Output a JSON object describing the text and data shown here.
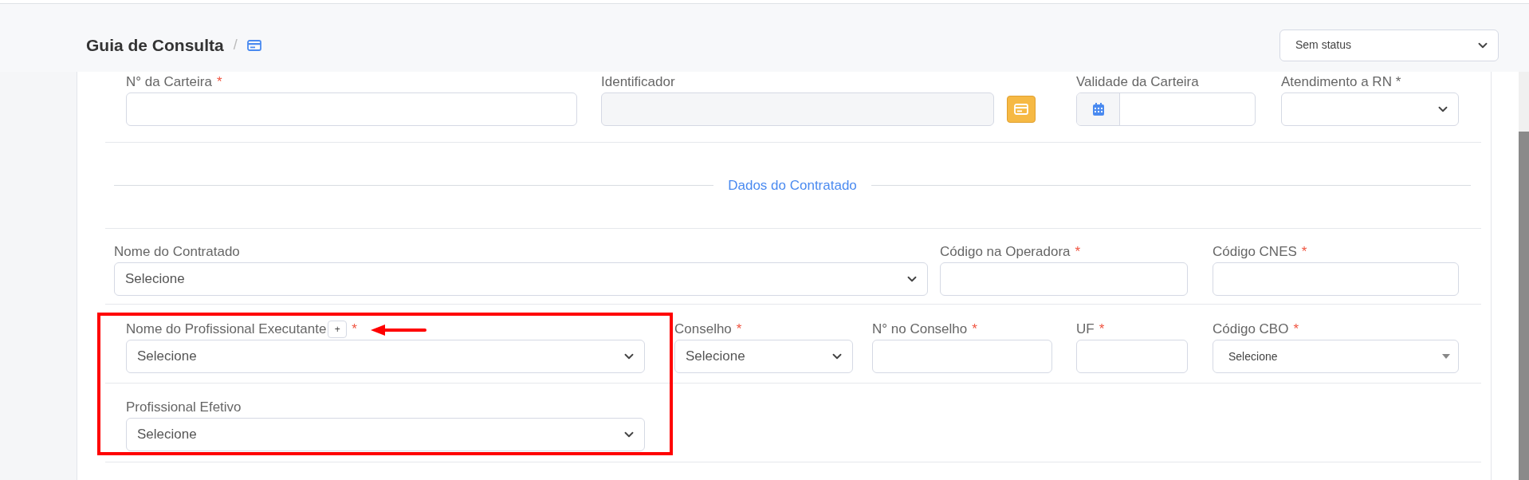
{
  "header": {
    "title": "Guia de Consulta",
    "separator": "/",
    "status_select": {
      "value": "Sem status"
    }
  },
  "rows": [
    {
      "fields": [
        {
          "label": "N° da Carteira",
          "required_mark": "*",
          "kind": "input"
        },
        {
          "label": "Identificador",
          "kind": "input",
          "disabled": true,
          "action_button": true
        },
        {
          "label": "Validade da Carteira",
          "kind": "date"
        },
        {
          "label": "Atendimento a RN *",
          "kind": "select"
        }
      ]
    },
    {
      "section_title": "Dados do Contratado"
    },
    {
      "fields": [
        {
          "label": "Nome do Contratado",
          "kind": "select",
          "value": "Selecione"
        },
        {
          "label": "Código na Operadora",
          "required_mark": "*",
          "kind": "input"
        },
        {
          "label": "Código CNES",
          "required_mark": "*",
          "kind": "input"
        }
      ]
    },
    {
      "fields": [
        {
          "label": "Nome do Profissional Executante",
          "required_mark": "*",
          "kind": "select",
          "value": "Selecione",
          "add_button": "+"
        },
        {
          "label": "Conselho",
          "required_mark": "*",
          "kind": "select",
          "value": "Selecione"
        },
        {
          "label": "N° no Conselho",
          "required_mark": "*",
          "kind": "input"
        },
        {
          "label": "UF",
          "required_mark": "*",
          "kind": "input"
        },
        {
          "label": "Código CBO",
          "required_mark": "*",
          "kind": "select2",
          "value": "Selecione"
        }
      ]
    },
    {
      "fields": [
        {
          "label": "Profissional Efetivo",
          "kind": "select",
          "value": "Selecione"
        }
      ]
    }
  ]
}
